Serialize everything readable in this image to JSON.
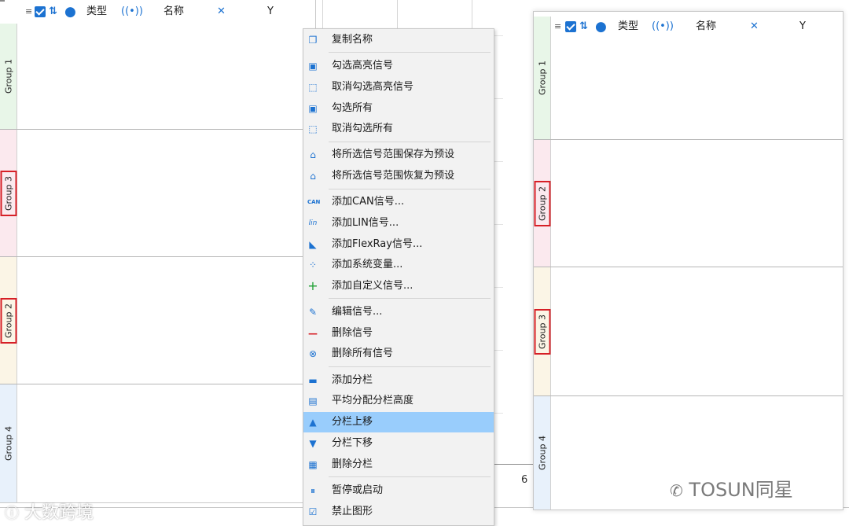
{
  "left_panel": {
    "header": {
      "type_label": "类型",
      "name_label": "名称",
      "y_label": "Y"
    },
    "groups": [
      {
        "label": "Group 1",
        "color": "#e8f6e8",
        "highlighted": false
      },
      {
        "label": "Group 3",
        "color": "#fbe9ee",
        "highlighted": true
      },
      {
        "label": "Group 2",
        "color": "#fbf5e6",
        "highlighted": true
      },
      {
        "label": "Group 4",
        "color": "#e8f1fb",
        "highlighted": false
      }
    ]
  },
  "chart_tick": "6",
  "context_menu": {
    "items": [
      {
        "label": "复制名称",
        "icon": "copy-icon"
      },
      {
        "label": "勾选高亮信号",
        "icon": "check-square-icon"
      },
      {
        "label": "取消勾选高亮信号",
        "icon": "dashed-square-icon"
      },
      {
        "label": "勾选所有",
        "icon": "check-square-icon"
      },
      {
        "label": "取消勾选所有",
        "icon": "dashed-square-icon"
      },
      {
        "label": "将所选信号范围保存为预设",
        "icon": "home-filled-icon"
      },
      {
        "label": "将所选信号范围恢复为预设",
        "icon": "home-outline-icon"
      },
      {
        "label": "添加CAN信号...",
        "icon": "can-icon"
      },
      {
        "label": "添加LIN信号...",
        "icon": "lin-icon"
      },
      {
        "label": "添加FlexRay信号...",
        "icon": "flexray-icon"
      },
      {
        "label": "添加系统变量...",
        "icon": "dots-icon"
      },
      {
        "label": "添加自定义信号...",
        "icon": "plus-icon"
      },
      {
        "label": "编辑信号...",
        "icon": "pencil-icon"
      },
      {
        "label": "删除信号",
        "icon": "minus-icon"
      },
      {
        "label": "删除所有信号",
        "icon": "x-circle-icon"
      },
      {
        "label": "添加分栏",
        "icon": "add-split-icon"
      },
      {
        "label": "平均分配分栏高度",
        "icon": "equal-split-icon"
      },
      {
        "label": "分栏上移",
        "icon": "triangle-up-icon",
        "active": true
      },
      {
        "label": "分栏下移",
        "icon": "triangle-down-icon"
      },
      {
        "label": "删除分栏",
        "icon": "grid-icon"
      },
      {
        "label": "暂停或启动",
        "icon": "pause-icon"
      },
      {
        "label": "禁止图形",
        "icon": "checkbox-icon"
      }
    ]
  },
  "right_panel": {
    "header": {
      "type_label": "类型",
      "name_label": "名称",
      "y_label": "Y"
    },
    "groups": [
      {
        "label": "Group 1",
        "color": "#e8f6e8",
        "highlighted": false
      },
      {
        "label": "Group 2",
        "color": "#fbe9ee",
        "highlighted": true
      },
      {
        "label": "Group 3",
        "color": "#fbf5e6",
        "highlighted": true
      },
      {
        "label": "Group 4",
        "color": "#e8f1fb",
        "highlighted": false
      }
    ]
  },
  "watermarks": {
    "left": "大数跨境",
    "right": "TOSUN同星"
  },
  "colors": {
    "accent": "#1c72d1",
    "highlight_border": "#d61f26",
    "menu_active": "#99cdfc"
  }
}
